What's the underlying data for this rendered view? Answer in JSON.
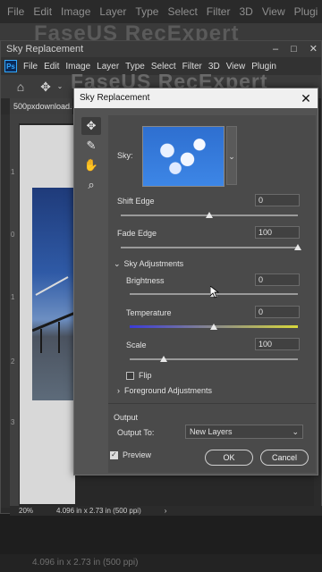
{
  "background_app": {
    "menu": [
      "File",
      "Edit",
      "Image",
      "Layer",
      "Type",
      "Select",
      "Filter",
      "3D",
      "View",
      "Plugi"
    ],
    "watermark": "FaseUS RecExpert",
    "status": "4.096 in x 2.73 in (500 ppi)"
  },
  "app": {
    "title": "Sky Replacement",
    "logo": "Ps",
    "menu": [
      "File",
      "Edit",
      "Image",
      "Layer",
      "Type",
      "Select",
      "Filter",
      "3D",
      "View",
      "Plugin"
    ],
    "window_controls": [
      "–",
      "□",
      "✕"
    ],
    "watermark": "FaseUS RecExpert",
    "doc_tab": "500pxdownload.ca",
    "ruler_marks": [
      "1",
      "0",
      "1",
      "2",
      "3"
    ],
    "status": {
      "zoom": "20%",
      "size": "4.096 in x 2.73 in (500 ppi)",
      "arrow": "›"
    }
  },
  "dialog": {
    "title": "Sky Replacement",
    "close": "✕",
    "tools": [
      "move-icon",
      "brush-icon",
      "hand-icon",
      "zoom-icon"
    ],
    "sky_label": "Sky:",
    "shift_edge": {
      "label": "Shift Edge",
      "value": "0",
      "level": 0.5
    },
    "fade_edge": {
      "label": "Fade Edge",
      "value": "100",
      "level": 1.0
    },
    "sky_adjustments": {
      "label": "Sky Adjustments",
      "brightness": {
        "label": "Brightness",
        "value": "0",
        "level": 0.5
      },
      "temperature": {
        "label": "Temperature",
        "value": "0",
        "level": 0.5
      },
      "scale": {
        "label": "Scale",
        "value": "100",
        "level": 0.2
      },
      "flip": {
        "label": "Flip",
        "checked": false
      }
    },
    "foreground_adjustments": {
      "label": "Foreground Adjustments"
    },
    "output": {
      "section_label": "Output",
      "output_to_label": "Output To:",
      "output_to_value": "New Layers"
    },
    "preview": {
      "label": "Preview",
      "checked": true
    },
    "ok_label": "OK",
    "cancel_label": "Cancel"
  },
  "colors": {
    "dialog_bg": "#535353",
    "panel_bg": "#4a4a4a",
    "accent": "#31a8ff"
  }
}
